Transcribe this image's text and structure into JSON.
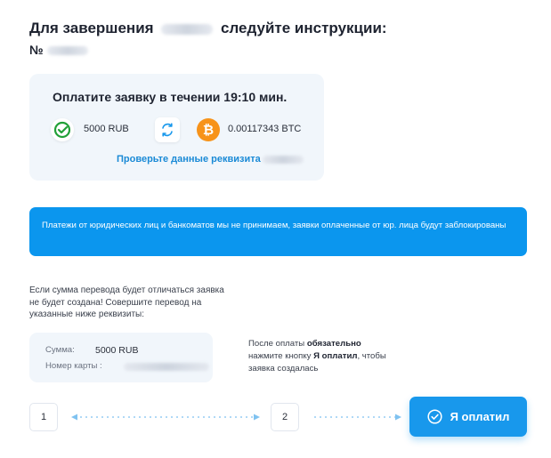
{
  "header": {
    "title_before": "Для завершения",
    "title_after": "следуйте инструкции:",
    "order_prefix": "№"
  },
  "payment": {
    "timer_text": "Оплатите заявку в течении 19:10 мин.",
    "from_amount": "5000 RUB",
    "to_amount": "0.00117343 BTC",
    "check_link": "Проверьте данные реквизита"
  },
  "notice": {
    "text": "Платежи от юридических лиц и банкоматов мы не принимаем, заявки оплаченные от юр. лица будут заблокированы"
  },
  "warning": {
    "text": "Если сумма перевода будет отличаться заявка не будет создана! Совершите перевод на указанные ниже реквизиты:"
  },
  "requisites": {
    "sum_label": "Сумма:",
    "sum_value": "5000 RUB",
    "card_label": "Номер карты :"
  },
  "after_payment": {
    "part1": "После оплаты",
    "part2": "обязательно",
    "part3": "нажмите кнопку",
    "part4": "Я оплатил",
    "part5": ", чтобы заявка создалась"
  },
  "steps": {
    "step1": "1",
    "step2": "2"
  },
  "button": {
    "paid_label": "Я оплатил"
  },
  "colors": {
    "accent": "#1898ec",
    "notice_bg": "#0b96ee",
    "card_bg": "#f1f6fb",
    "btc": "#f7931a",
    "sber": "#21a038"
  },
  "icons": {
    "sber": "sberbank-logo-icon",
    "swap": "refresh-swap-icon",
    "btc": "bitcoin-icon",
    "button": "check-circle-icon"
  }
}
